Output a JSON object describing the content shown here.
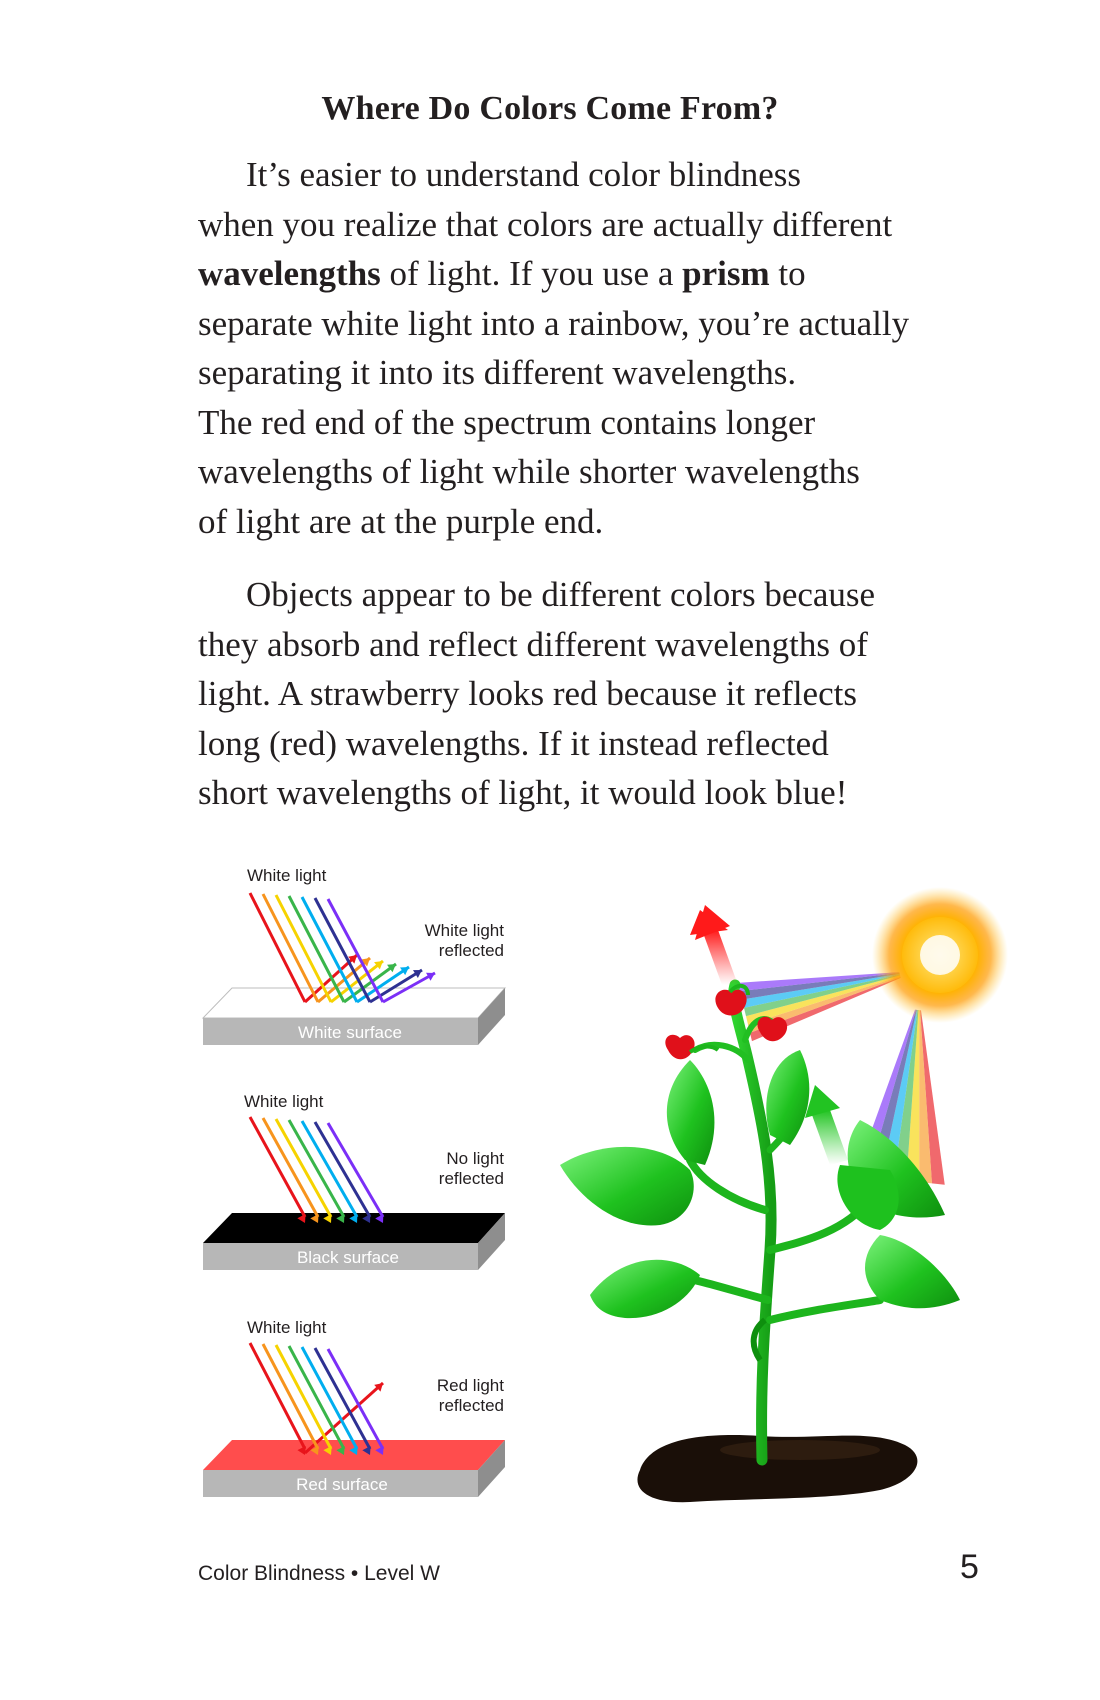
{
  "heading": "Where Do Colors Come From?",
  "paragraph1": {
    "lines": [
      [
        {
          "t": "It’s easier to understand color blindness",
          "b": false
        }
      ],
      [
        {
          "t": "when you realize that colors are actually different",
          "b": false
        }
      ],
      [
        {
          "t": "wavelengths",
          "b": true
        },
        {
          "t": " of light. If you use a ",
          "b": false
        },
        {
          "t": "prism",
          "b": true
        },
        {
          "t": " to",
          "b": false
        }
      ],
      [
        {
          "t": "separate white light into a rainbow, you’re actually",
          "b": false
        }
      ],
      [
        {
          "t": "separating it into its different wavelengths.",
          "b": false
        }
      ],
      [
        {
          "t": "The red end of the spectrum contains longer",
          "b": false
        }
      ],
      [
        {
          "t": "wavelengths of light while shorter wavelengths",
          "b": false
        }
      ],
      [
        {
          "t": "of light are at the purple end.",
          "b": false
        }
      ]
    ]
  },
  "paragraph2": {
    "lines": [
      "Objects appear to be different colors because",
      "they absorb and reflect different wavelengths of",
      "light. A strawberry looks red because it reflects",
      "long (red) wavelengths. If it instead reflected",
      "short wavelengths of light, it would look blue!"
    ]
  },
  "diagrams": {
    "white": {
      "incoming": "White light",
      "result_line1": "White light",
      "result_line2": "reflected",
      "surface": "White surface",
      "surface_color": "#ffffff"
    },
    "black": {
      "incoming": "White light",
      "result_line1": "No light",
      "result_line2": "reflected",
      "surface": "Black surface",
      "surface_color": "#000000"
    },
    "red": {
      "incoming": "White light",
      "result_line1": "Red light",
      "result_line2": "reflected",
      "surface": "Red surface",
      "surface_color": "#ff4d4d"
    }
  },
  "spectrum_colors": [
    "#e8141b",
    "#f7941d",
    "#f6d300",
    "#39b54a",
    "#00aeef",
    "#2e3192",
    "#7b2ff7"
  ],
  "footer": {
    "title": "Color Blindness • Level W",
    "page_number": "5"
  }
}
